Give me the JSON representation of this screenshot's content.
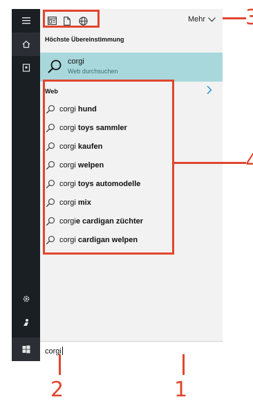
{
  "left_bar": {
    "icons": [
      "hamburger-icon",
      "home-icon",
      "notebook-icon",
      "settings-icon",
      "feedback-icon",
      "windows-start-icon"
    ]
  },
  "filter_bar": {
    "icons": [
      "apps-filter-icon",
      "documents-filter-icon",
      "web-filter-icon"
    ],
    "more_label": "Mehr"
  },
  "best_match": {
    "header": "Höchste Übereinstimmung",
    "title": "corgi",
    "subtitle": "Web durchsuchen"
  },
  "web": {
    "header": "Web",
    "suggestions": [
      {
        "prefix": "corgi",
        "bold": "hund"
      },
      {
        "prefix": "corgi",
        "bold": "toys sammler"
      },
      {
        "prefix": "corgi",
        "bold": "kaufen"
      },
      {
        "prefix": "corgi",
        "bold": "welpen"
      },
      {
        "prefix": "corgi",
        "bold": "toys automodelle"
      },
      {
        "prefix": "corgi",
        "bold": "mix"
      },
      {
        "prefix": "corgi",
        "bold": "e cardigan züchter"
      },
      {
        "prefix": "corgi",
        "bold": "cardigan welpen"
      }
    ]
  },
  "search": {
    "value": "corgi"
  },
  "callouts": {
    "c1": "1",
    "c2": "2",
    "c3": "3",
    "c4": "4"
  },
  "colors": {
    "accent": "#e0462e",
    "highlight": "#a8d8dc",
    "sidebar": "#1a1f24"
  }
}
